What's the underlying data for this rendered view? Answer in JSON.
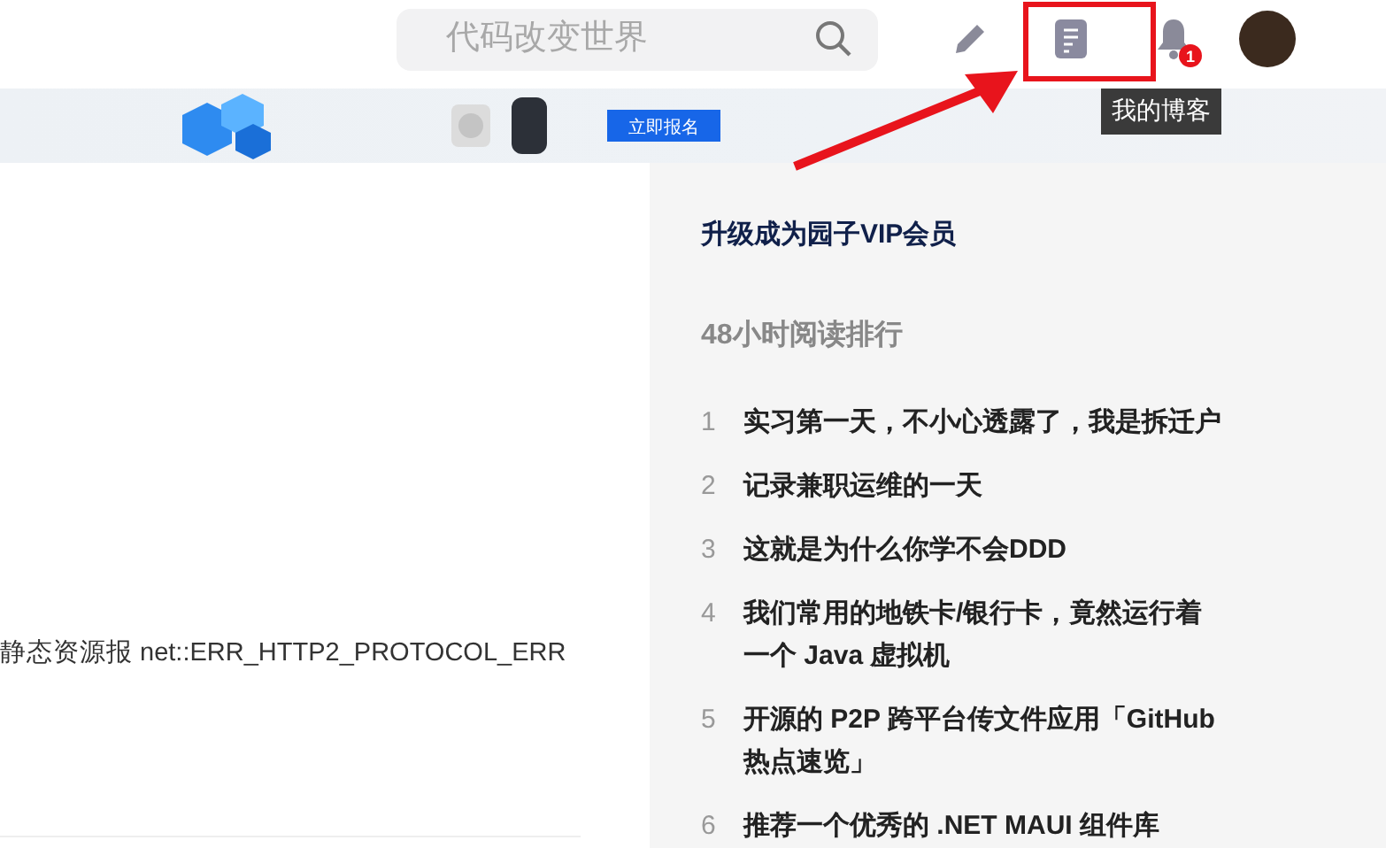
{
  "header": {
    "search": {
      "placeholder": "代码改变世界"
    },
    "notification_count": "1",
    "tooltip": "我的博客"
  },
  "banner": {
    "button": "立即报名"
  },
  "article": {
    "text": "静态资源报 net::ERR_HTTP2_PROTOCOL_ERR"
  },
  "sidebar": {
    "vip_link": "升级成为园子VIP会员",
    "ranking_title": "48小时阅读排行",
    "ranking": [
      {
        "rank": "1",
        "title": "实习第一天，不小心透露了，我是拆迁户"
      },
      {
        "rank": "2",
        "title": "记录兼职运维的一天"
      },
      {
        "rank": "3",
        "title": "这就是为什么你学不会DDD"
      },
      {
        "rank": "4",
        "title": "我们常用的地铁卡/银行卡，竟然运行着一个 Java 虚拟机"
      },
      {
        "rank": "5",
        "title": "开源的 P2P 跨平台传文件应用「GitHub 热点速览」"
      },
      {
        "rank": "6",
        "title": "推荐一个优秀的 .NET MAUI 组件库"
      }
    ]
  }
}
